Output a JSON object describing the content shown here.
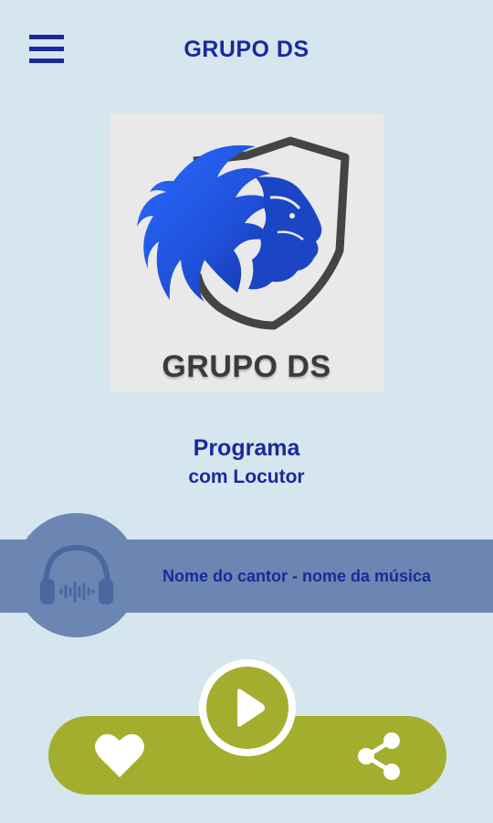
{
  "header": {
    "title": "GRUPO DS",
    "menu_icon": "hamburger-menu-icon"
  },
  "logo": {
    "text": "GRUPO DS",
    "image": "lion-shield-logo",
    "colors": {
      "lion": "#1f55e8",
      "shield": "#4a4a4a",
      "background": "#e9e9e9"
    }
  },
  "program": {
    "title": "Programa",
    "subtitle": "com Locutor"
  },
  "now_playing": {
    "text": "Nome do cantor - nome da música",
    "icon": "headphones-audio-icon"
  },
  "controls": {
    "like_icon": "heart-icon",
    "play_icon": "play-icon",
    "share_icon": "share-icon"
  },
  "colors": {
    "background": "#d6e6ee",
    "primary_text": "#1a2a9a",
    "now_playing_bar": "#6b86b2",
    "control_bar": "#a3ae2e"
  }
}
